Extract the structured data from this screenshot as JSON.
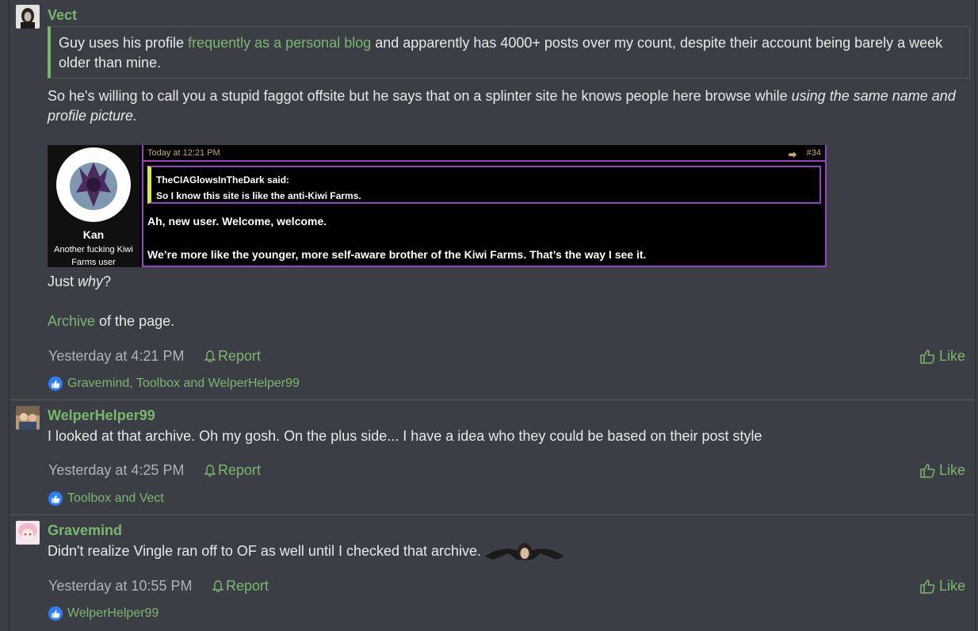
{
  "posts": [
    {
      "username": "Vect",
      "quote": {
        "before": "Guy uses his profile ",
        "link": "frequently as a personal blog",
        "after": " and apparently has 4000+ posts over my count, despite their account being barely a week older than mine."
      },
      "para1": {
        "text": "So he's willing to call you a stupid faggot offsite but he says that on a splinter site he knows people here browse while ",
        "emph": "using the same name and profile picture."
      },
      "embed": {
        "name": "Kan",
        "title": "Another fucking Kiwi Farms user",
        "time": "Today at 12:21 PM",
        "post_num": "#34",
        "quote_author": "TheCIAGlowsInTheDark said:",
        "quote_text": "So I know this site is like the anti-Kiwi Farms.",
        "line1": "Ah, new user. Welcome, welcome.",
        "line2": "We’re more like the younger, more self-aware brother of the Kiwi Farms. That’s the way I see it."
      },
      "para2": {
        "text": "Just ",
        "emph": "why",
        "end": "?"
      },
      "para3": {
        "link": "Archive",
        "text": " of the page."
      },
      "timestamp": "Yesterday at 4:21 PM",
      "report_label": "Report",
      "like_label": "Like",
      "likes": "Gravemind, Toolbox and WelperHelper99"
    },
    {
      "username": "WelperHelper99",
      "text": "I looked at that archive. Oh my gosh. On the plus side... I have a idea who they could be based on their post style",
      "timestamp": "Yesterday at 4:25 PM",
      "report_label": "Report",
      "like_label": "Like",
      "likes": "Toolbox and Vect"
    },
    {
      "username": "Gravemind",
      "text": "Didn't realize Vingle ran off to OF as well until I checked that archive.",
      "timestamp": "Yesterday at 10:55 PM",
      "report_label": "Report",
      "like_label": "Like",
      "likes": "WelperHelper99"
    }
  ],
  "colors": {
    "accent": "#7ab76d",
    "background": "#3b3e45",
    "meta": "#b0b2b6",
    "embed_border": "#9a3fc9"
  }
}
